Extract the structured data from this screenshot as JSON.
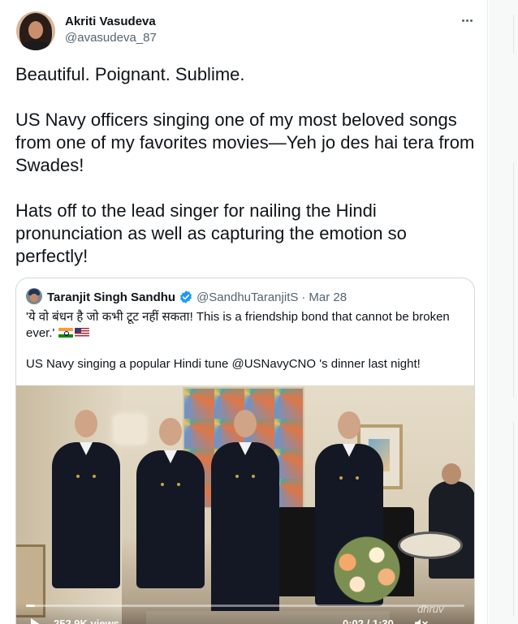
{
  "author": {
    "display_name": "Akriti Vasudeva",
    "handle": "@avasudeva_87"
  },
  "tweet": {
    "paragraphs": [
      "Beautiful. Poignant. Sublime.",
      "US Navy officers singing one of my most beloved songs from one of my favorites movies—Yeh jo des hai tera from Swades!",
      "Hats off to the lead singer for nailing the Hindi pronunciation as well as capturing the emotion so perfectly!"
    ]
  },
  "quoted_tweet": {
    "display_name": "Taranjit Singh Sandhu",
    "handle": "@SandhuTaranjitS",
    "separator": "·",
    "date": "Mar 28",
    "text_line1": "'ये वो बंधन है जो कभी टूट नहीं सकता! This is a friendship bond that cannot be broken ever.'",
    "flags": [
      "india-flag-icon",
      "us-flag-icon"
    ],
    "text_line2": "US Navy singing a popular Hindi tune @USNavyCNO 's dinner last night!",
    "video": {
      "views": "252.9K views",
      "time": "0:02 / 1:30",
      "watermark": "dhruv",
      "progress_fraction": 0.02
    }
  },
  "colors": {
    "text_primary": "#0f1419",
    "text_secondary": "#536471",
    "verified": "#1d9bf0",
    "border": "#cfd9de"
  },
  "icons": [
    "more-icon",
    "verified-icon",
    "play-icon",
    "mute-icon"
  ]
}
